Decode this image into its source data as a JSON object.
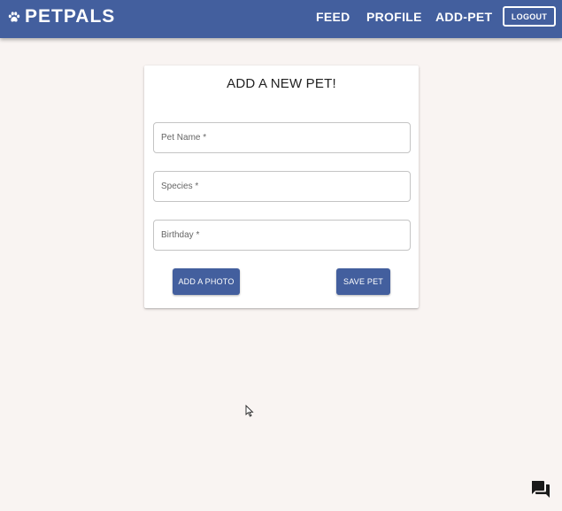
{
  "app": {
    "brand": "PETPALS",
    "brand_icon": "paw-icon"
  },
  "nav": {
    "feed": "FEED",
    "profile": "PROFILE",
    "add_pet": "ADD-PET",
    "logout": "LOGOUT"
  },
  "form": {
    "title": "ADD A NEW PET!",
    "pet_name_placeholder": "Pet Name *",
    "species_placeholder": "Species *",
    "birthday_placeholder": "Birthday *",
    "pet_name_value": "",
    "species_value": "",
    "birthday_value": "",
    "add_photo_label": "ADD A PHOTO",
    "save_label": "SAVE PET"
  },
  "colors": {
    "primary": "#435f9e",
    "background": "#f9f4f2",
    "card": "#ffffff"
  },
  "icons": {
    "chat": "question-answer-icon",
    "cursor": "mouse-pointer-icon"
  }
}
